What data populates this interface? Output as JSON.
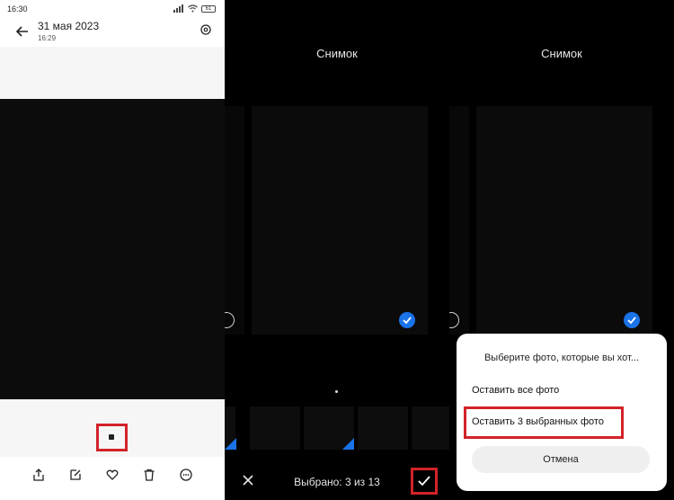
{
  "viewer": {
    "status_time": "16:30",
    "battery": "61",
    "date": "31 мая 2023",
    "time": "16:29",
    "tools": [
      "share-icon",
      "edit-icon",
      "favorite-icon",
      "delete-icon",
      "more-icon"
    ]
  },
  "burst": {
    "title": "Снимок",
    "counter": "Выбрано: 3 из 13"
  },
  "burst_dialog": {
    "title": "Снимок",
    "sheet_title": "Выберите фото, которые вы хот...",
    "keep_all": "Оставить все фото",
    "keep_selected": "Оставить 3 выбранных фото",
    "cancel": "Отмена"
  },
  "colors": {
    "accent": "#1a73e8",
    "highlight": "#d2232a"
  }
}
